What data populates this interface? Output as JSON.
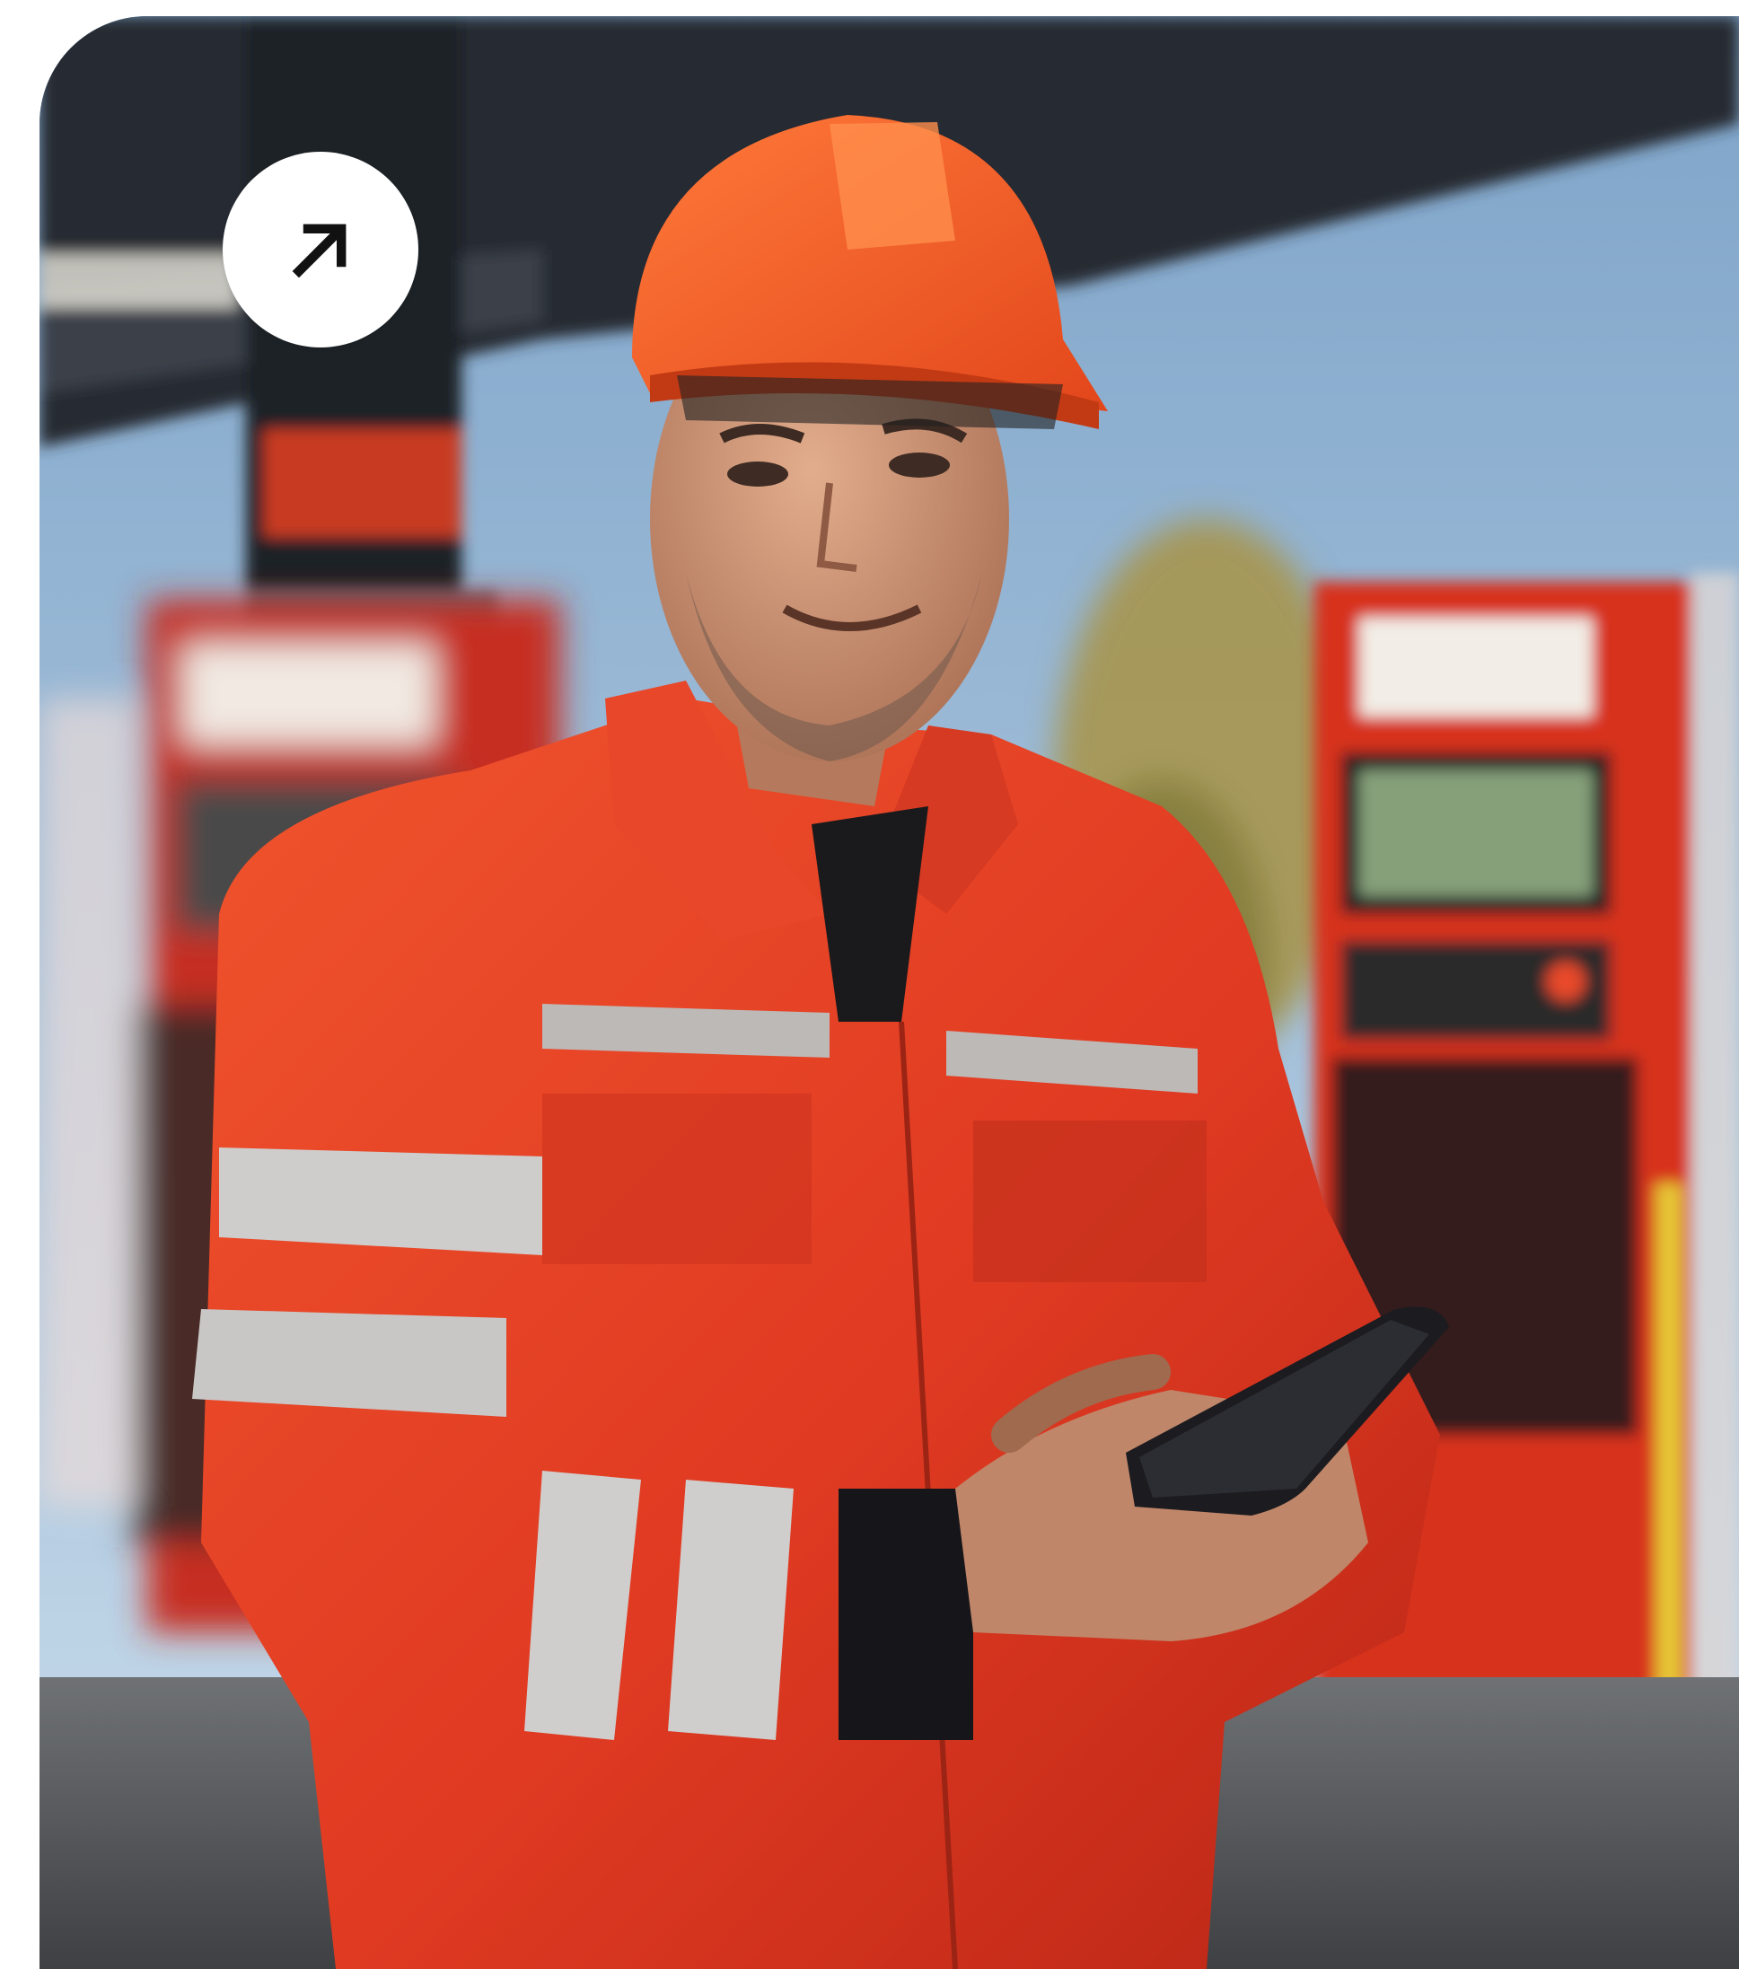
{
  "card": {
    "image_subject": "worker-in-hard-hat-with-tablet-at-fuel-station",
    "colors": {
      "sky": "#9fc0de",
      "canopy": "#2b2e36",
      "uniform": "#e8442a",
      "helmet": "#f2581f",
      "reflective": "#c9c9c9",
      "pump_red": "#d7301f",
      "ground": "#55585c"
    }
  },
  "link_button": {
    "icon": "arrow-up-right-icon",
    "background": "#ffffff",
    "icon_color": "#111111"
  }
}
